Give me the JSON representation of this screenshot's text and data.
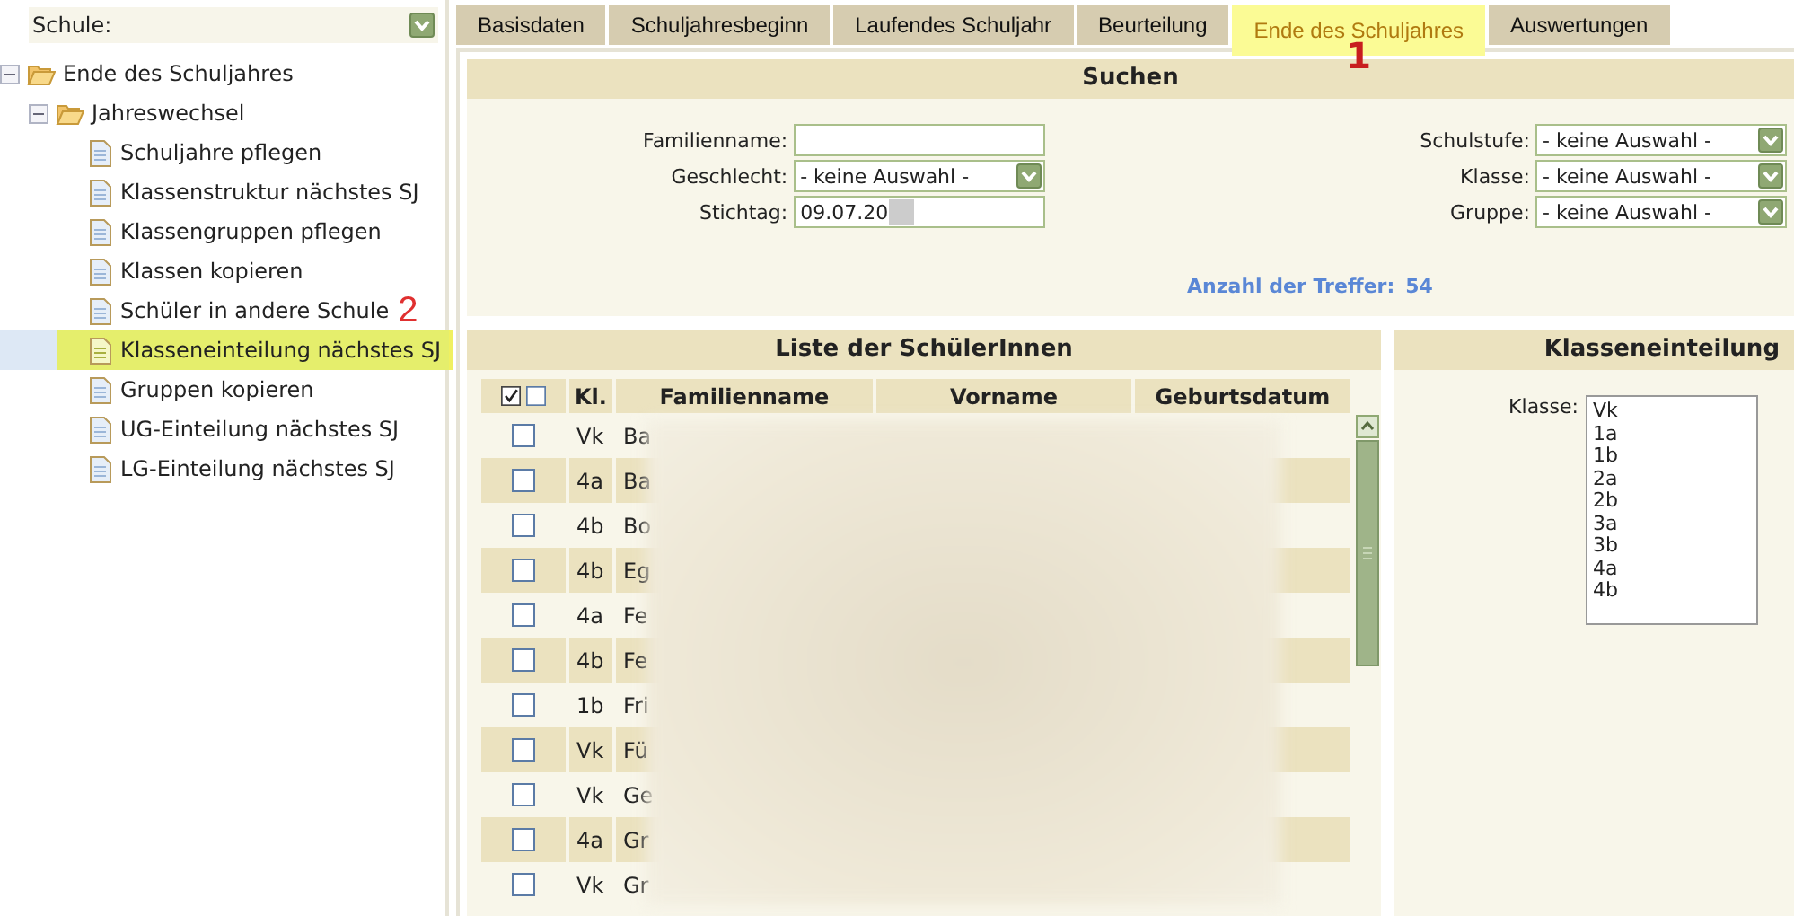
{
  "school": {
    "label": "Schule:"
  },
  "tree": [
    {
      "label": "Ende des Schuljahres",
      "expanded": true,
      "children": [
        {
          "label": "Jahreswechsel",
          "expanded": true,
          "children": [
            {
              "label": "Schuljahre pflegen",
              "selected": false
            },
            {
              "label": "Klassenstruktur nächstes SJ",
              "selected": false
            },
            {
              "label": "Klassengruppen pflegen",
              "selected": false
            },
            {
              "label": "Klassen kopieren",
              "selected": false
            },
            {
              "label": "Schüler in andere Schule",
              "selected": false,
              "annotation": "2"
            },
            {
              "label": "Klasseneinteilung nächstes SJ",
              "selected": true
            },
            {
              "label": "Gruppen kopieren",
              "selected": false
            },
            {
              "label": "UG-Einteilung nächstes SJ",
              "selected": false
            },
            {
              "label": "LG-Einteilung nächstes SJ",
              "selected": false
            }
          ]
        }
      ]
    }
  ],
  "tabs": [
    {
      "label": "Basisdaten",
      "selected": false
    },
    {
      "label": "Schuljahresbeginn",
      "selected": false
    },
    {
      "label": "Laufendes Schuljahr",
      "selected": false
    },
    {
      "label": "Beurteilung",
      "selected": false
    },
    {
      "label": "Ende des Schuljahres",
      "selected": true,
      "annotation": "1"
    },
    {
      "label": "Auswertungen",
      "selected": false
    }
  ],
  "search": {
    "title": "Suchen",
    "left_fields": [
      {
        "label": "Familienname:",
        "kind": "text"
      },
      {
        "label": "Geschlecht:",
        "kind": "select",
        "value": "- keine Auswahl -"
      },
      {
        "label": "Stichtag:",
        "kind": "text",
        "value": "09.07.20",
        "redacted": true
      }
    ],
    "right_fields": [
      {
        "label": "Schulstufe:",
        "kind": "select",
        "value": "- keine Auswahl -"
      },
      {
        "label": "Klasse:",
        "kind": "select",
        "value": "- keine Auswahl -"
      },
      {
        "label": "Gruppe:",
        "kind": "select",
        "value": "- keine Auswahl -"
      }
    ],
    "hits": {
      "label": "Anzahl der Treffer:",
      "value": "54"
    }
  },
  "student_list": {
    "title": "Liste der SchülerInnen",
    "header_checkboxes": [
      {
        "checked": true
      },
      {
        "checked": false
      }
    ],
    "columns": [
      "Kl.",
      "Familienname",
      "Vorname",
      "Geburtsdatum"
    ],
    "rows": [
      {
        "checked": false,
        "class": "Vk",
        "name": "Ba"
      },
      {
        "checked": false,
        "class": "4a",
        "name": "Ba"
      },
      {
        "checked": false,
        "class": "4b",
        "name": "Bo"
      },
      {
        "checked": false,
        "class": "4b",
        "name": "Eg"
      },
      {
        "checked": false,
        "class": "4a",
        "name": "Fe"
      },
      {
        "checked": false,
        "class": "4b",
        "name": "Fe"
      },
      {
        "checked": false,
        "class": "1b",
        "name": "Fri"
      },
      {
        "checked": false,
        "class": "Vk",
        "name": "Fü"
      },
      {
        "checked": false,
        "class": "Vk",
        "name": "Ge"
      },
      {
        "checked": false,
        "class": "4a",
        "name": "Gr"
      },
      {
        "checked": false,
        "class": "Vk",
        "name": "Gr"
      }
    ]
  },
  "class_assignment": {
    "title": "Klasseneinteilung",
    "label": "Klasse:",
    "options": [
      "Vk",
      "1a",
      "1b",
      "2a",
      "2b",
      "3a",
      "3b",
      "4a",
      "4b"
    ]
  }
}
